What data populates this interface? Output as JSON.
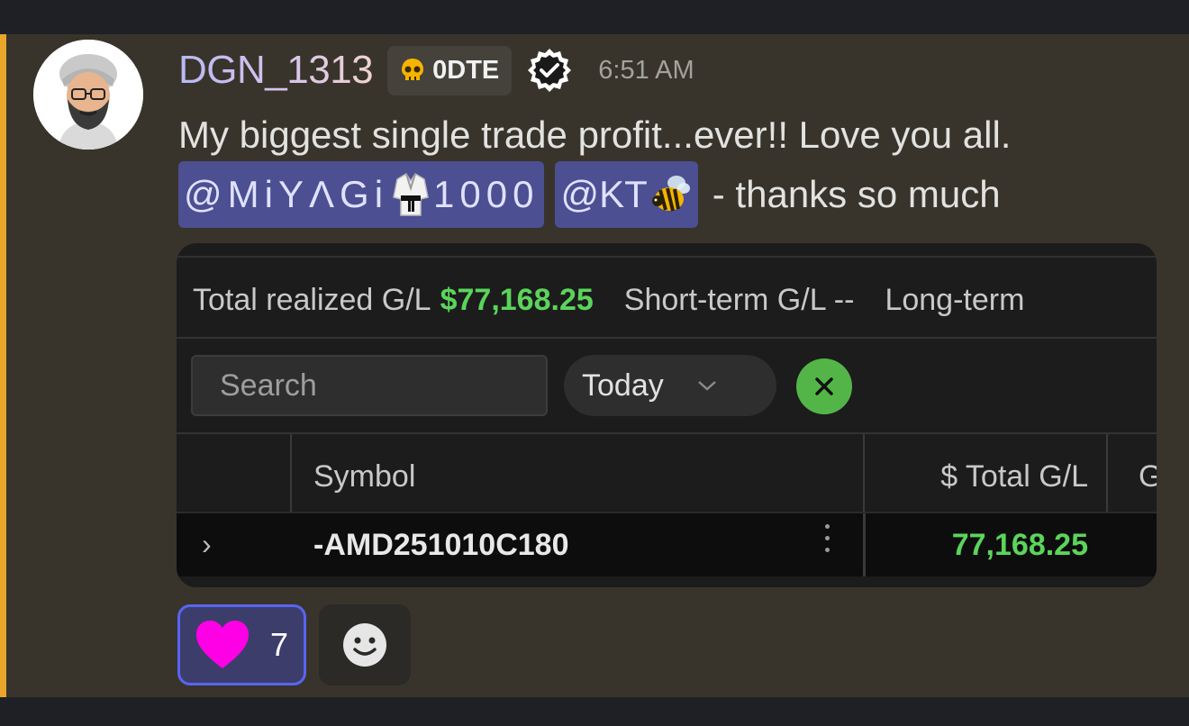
{
  "message": {
    "author": "DGN_1313",
    "role_tag": {
      "icon": "skull-icon",
      "label": "0DTE"
    },
    "verified_icon": "verified-check-icon",
    "time": "6:51 AM",
    "text_line1": "My biggest single trade profit...ever!! Love you all.",
    "mentions": [
      {
        "text_before": "@MiYΛGi",
        "emoji": "martial-arts-uniform-icon",
        "text_after": "1000"
      },
      {
        "text_before": "@KT",
        "emoji": "bee-icon",
        "text_after": ""
      }
    ],
    "text_after_mentions": "- thanks so much"
  },
  "embed": {
    "summary": {
      "realized_label": "Total realized G/L",
      "realized_value": "$77,168.25",
      "short_term": "Short-term G/L --",
      "long_term": "Long-term"
    },
    "search_placeholder": "Search",
    "date_filter": "Today",
    "table": {
      "headers": {
        "symbol": "Symbol",
        "total": "$ Total G/L",
        "next": "G"
      },
      "rows": [
        {
          "expand": "›",
          "symbol": "-AMD251010C180",
          "total": "77,168.25"
        }
      ]
    }
  },
  "reactions": [
    {
      "icon": "heart-icon",
      "count": "7",
      "color": "#ff00e6"
    }
  ],
  "colors": {
    "mention_bg": "#4c4f91",
    "gain": "#5bd45b",
    "highlight": "#e9a62b",
    "clear": "#53b548"
  }
}
